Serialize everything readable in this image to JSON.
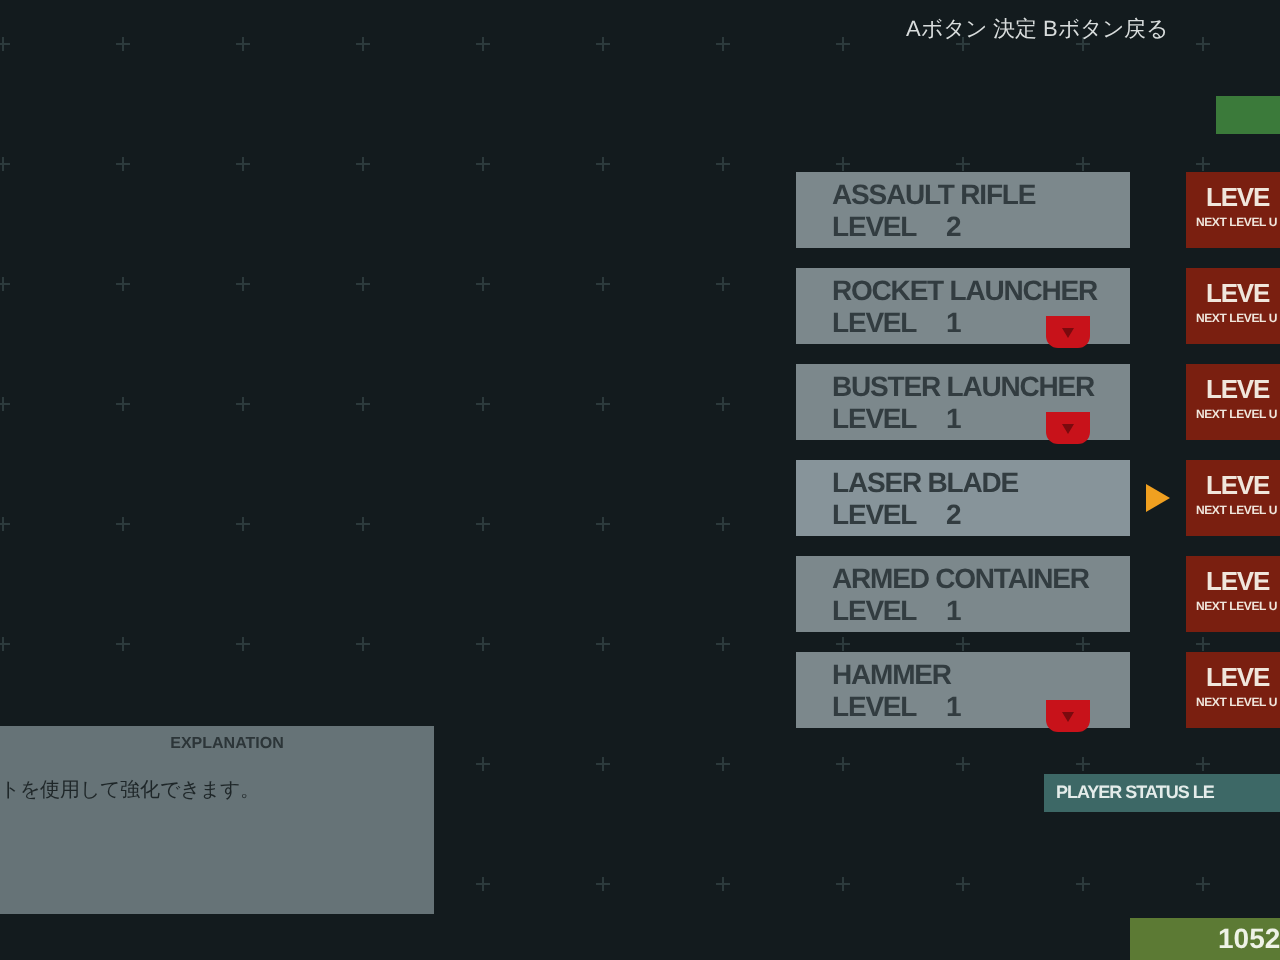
{
  "hint": "Aボタン 決定 Bボタン戻る",
  "weapons": [
    {
      "name": "ASSAULT RIFLE",
      "level_label": "LEVEL",
      "level": "2",
      "selected": false,
      "marker": false,
      "panel_title": "LEVE",
      "panel_sub": "NEXT LEVEL U"
    },
    {
      "name": "ROCKET LAUNCHER",
      "level_label": "LEVEL",
      "level": "1",
      "selected": false,
      "marker": true,
      "panel_title": "LEVE",
      "panel_sub": "NEXT LEVEL U"
    },
    {
      "name": "BUSTER LAUNCHER",
      "level_label": "LEVEL",
      "level": "1",
      "selected": false,
      "marker": true,
      "panel_title": "LEVE",
      "panel_sub": "NEXT LEVEL U"
    },
    {
      "name": "LASER BLADE",
      "level_label": "LEVEL",
      "level": "2",
      "selected": true,
      "marker": false,
      "panel_title": "LEVE",
      "panel_sub": "NEXT LEVEL U"
    },
    {
      "name": "ARMED CONTAINER",
      "level_label": "LEVEL",
      "level": "1",
      "selected": false,
      "marker": false,
      "panel_title": "LEVE",
      "panel_sub": "NEXT LEVEL U"
    },
    {
      "name": "HAMMER",
      "level_label": "LEVEL",
      "level": "1",
      "selected": false,
      "marker": true,
      "panel_title": "LEVE",
      "panel_sub": "NEXT LEVEL U"
    }
  ],
  "explanation": {
    "title": "EXPLANATION",
    "text": "トを使用して強化できます。"
  },
  "player_status": "PLAYER STATUS LE",
  "points": "1052"
}
